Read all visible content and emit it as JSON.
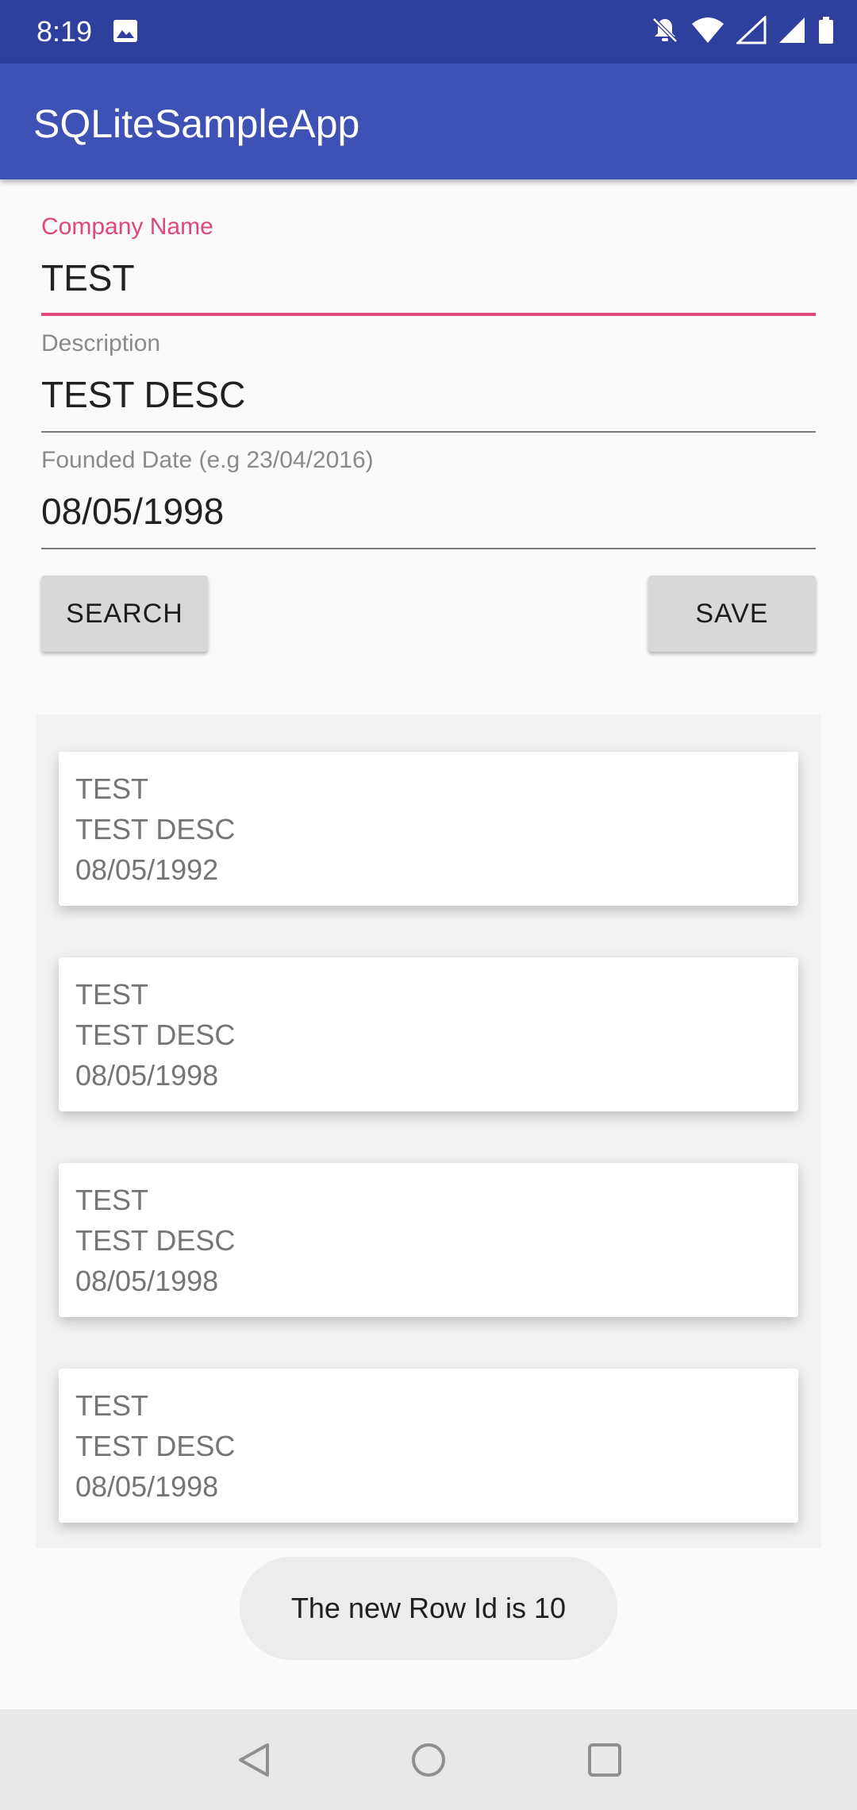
{
  "status_bar": {
    "time": "8:19",
    "icons": [
      "image-icon",
      "notifications-off-icon",
      "wifi-icon",
      "signal-empty-icon",
      "signal-full-icon",
      "battery-icon"
    ]
  },
  "app_bar": {
    "title": "SQLiteSampleApp"
  },
  "form": {
    "company_name": {
      "label": "Company Name",
      "value": "TEST"
    },
    "description": {
      "label": "Description",
      "value": "TEST DESC"
    },
    "founded_date": {
      "label": "Founded Date (e.g 23/04/2016)",
      "value": "08/05/1998"
    }
  },
  "buttons": {
    "search_label": "SEARCH",
    "save_label": "SAVE"
  },
  "list": {
    "items": [
      {
        "name": "TEST",
        "description": "TEST DESC",
        "date": "08/05/1992"
      },
      {
        "name": "TEST",
        "description": "TEST DESC",
        "date": "08/05/1998"
      },
      {
        "name": "TEST",
        "description": "TEST DESC",
        "date": "08/05/1998"
      },
      {
        "name": "TEST",
        "description": "TEST DESC",
        "date": "08/05/1998"
      }
    ]
  },
  "toast": {
    "message": "The new Row Id is 10"
  },
  "nav_bar": {
    "icons": [
      "back-icon",
      "home-icon",
      "recents-icon"
    ]
  },
  "colors": {
    "status_bar": "#2f3f9e",
    "app_bar": "#3f51b5",
    "accent": "#e0457b"
  }
}
